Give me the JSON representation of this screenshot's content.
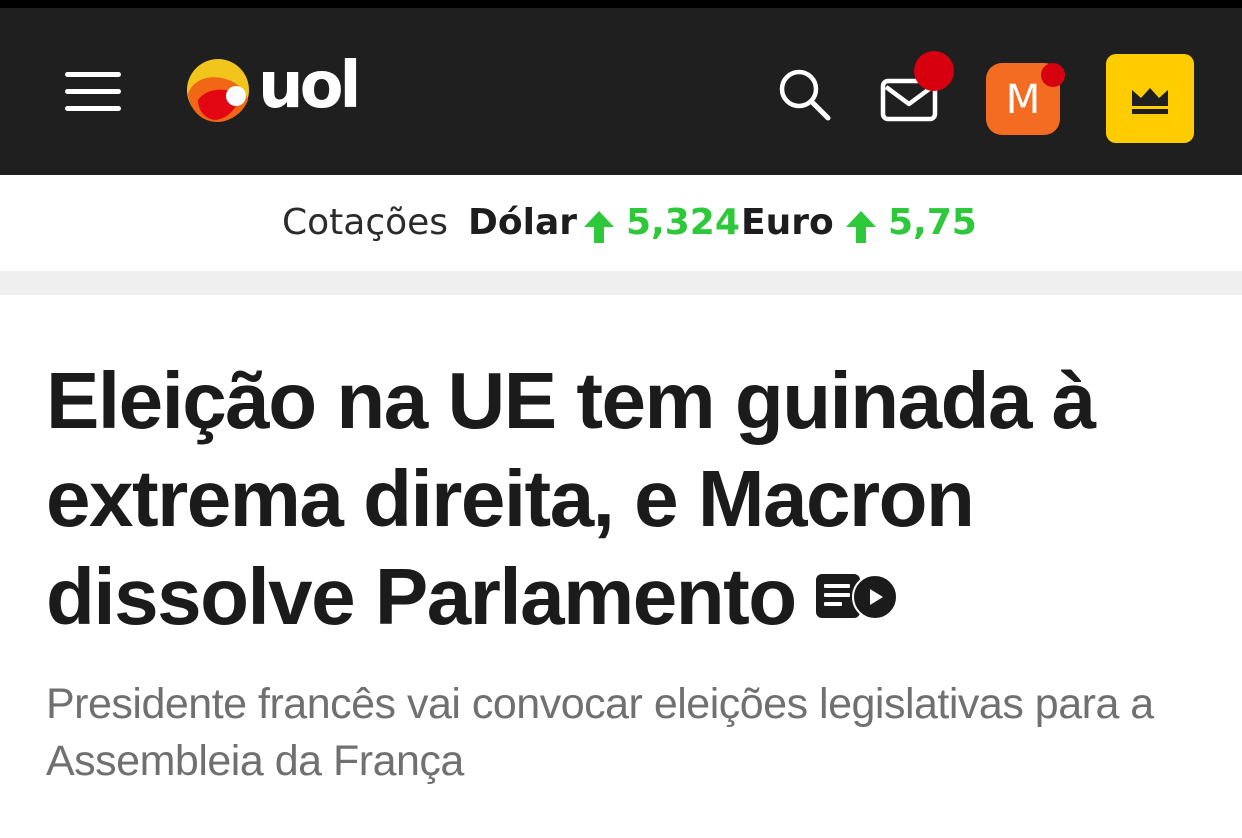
{
  "header": {
    "logo_text": "uol",
    "avatar_letter": "M",
    "colors": {
      "background": "#1f1f1f",
      "notification": "#d6000f",
      "avatar": "#f46c21",
      "vip": "#ffcc00"
    },
    "icons": [
      "menu-icon",
      "uol-logo",
      "search-icon",
      "mail-icon",
      "crown-icon"
    ]
  },
  "quotes": {
    "label": "Cotações",
    "items": [
      {
        "name": "Dólar",
        "value": "5,324",
        "trend": "up"
      },
      {
        "name": "Euro",
        "value": "5,75",
        "trend": "up"
      }
    ],
    "trend_color": "#2ec83b"
  },
  "article": {
    "headline_lines": [
      "Eleição na UE tem guinada à",
      "extrema direita, e Macron",
      "dissolve Parlamento"
    ],
    "subhead": "Presidente francês vai convocar eleições legislativas para a Assembleia da França",
    "media_icon": "text-video-icon"
  }
}
